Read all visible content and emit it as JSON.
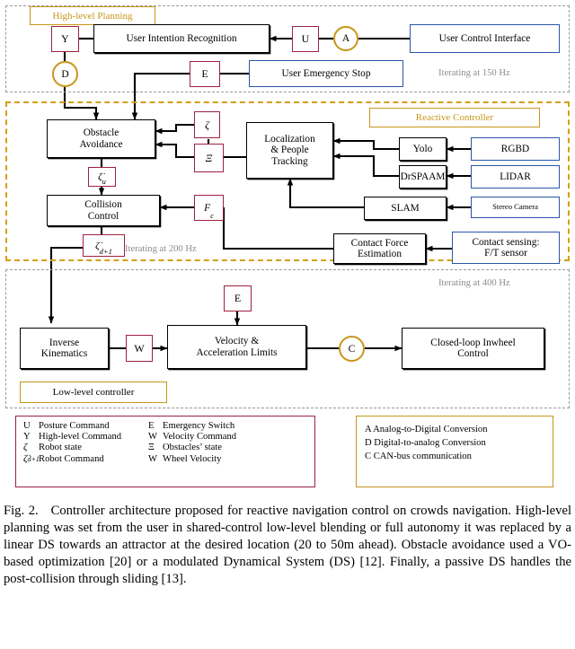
{
  "figure": {
    "sections": [
      {
        "id": "high-level-planning",
        "title": "High-level Planning",
        "rate": "Iterating at 150 Hz"
      },
      {
        "id": "reactive-controller",
        "title": "Reactive Controller",
        "rate": "Iterating at 200 Hz"
      },
      {
        "id": "low-level-controller",
        "title": "Low-level controller",
        "rate": "Iterating at 400 Hz"
      }
    ],
    "nodes": {
      "user_intention_recognition": "User Intention Recognition",
      "user_control_interface": "User Control Interface",
      "user_emergency_stop": "User Emergency Stop",
      "obstacle_avoidance_l1": "Obstacle",
      "obstacle_avoidance_l2": "Avoidance",
      "collision_control_l1": "Collision",
      "collision_control_l2": "Control",
      "localization_l1": "Localization",
      "localization_l2": "& People",
      "localization_l3": "Tracking",
      "yolo": "Yolo",
      "drspaam": "DrSPAAM",
      "slam": "SLAM",
      "rgbd": "RGBD",
      "lidar": "LIDAR",
      "stereo_camera": "Stereo Camera",
      "contact_force_l1": "Contact Force",
      "contact_force_l2": "Estimation",
      "contact_sensing_l1": "Contact sensing:",
      "contact_sensing_l2": "F/T sensor",
      "inverse_kinematics_l1": "Inverse",
      "inverse_kinematics_l2": "Kinematics",
      "velocity_limits_l1": "Velocity &",
      "velocity_limits_l2": "Acceleration Limits",
      "closed_loop_l1": "Closed-loop Inwheel",
      "closed_loop_l2": "Control"
    },
    "signals": {
      "y": "Y",
      "u": "U",
      "e_top": "E",
      "e_low": "E",
      "zeta": "ζ",
      "xi": "Ξ",
      "zeta_u": "ζ",
      "zeta_u_sub": "u",
      "fc": "F",
      "fc_sub": "c",
      "zeta_d": "ζ",
      "zeta_d_sub": "d+1",
      "w": "W"
    },
    "converters": {
      "a": "A",
      "d": "D",
      "c": "C"
    },
    "legend_signals": {
      "rows": [
        {
          "sym": "U",
          "italic": false,
          "text": "Posture Command",
          "sym2": "E",
          "italic2": false,
          "text2": "Emergency Switch"
        },
        {
          "sym": "Y",
          "italic": false,
          "text": "High-level Command",
          "sym2": "W",
          "italic2": false,
          "text2": "Velocity Command"
        },
        {
          "sym": "ζ",
          "italic": true,
          "text": "Robot state",
          "sym2": "Ξ",
          "italic2": false,
          "text2": "Obstacles’ state"
        },
        {
          "sym": "ζd+1",
          "italic": true,
          "text": "Robot Command",
          "sym2": "W",
          "italic2": false,
          "text2": "Wheel Velocity"
        }
      ]
    },
    "legend_converters": {
      "lines": [
        "A Analog-to-Digital Conversion",
        "D Digital-to-analog Conversion",
        "C CAN-bus communication"
      ]
    },
    "colors": {
      "crimson": "#9e2140",
      "gold": "#c8961a",
      "blue": "#2b56a8",
      "gray_dash": "#9a9a9a",
      "rate_text": "#8c8c8c"
    }
  },
  "caption": {
    "label": "Fig. 2.",
    "text": "Controller architecture proposed for reactive navigation control on crowds navigation. High-level planning was set from the user in shared-control low-level blending or full autonomy it was replaced by a linear DS towards an attractor at the desired location (20 to 50m ahead). Obstacle avoidance used a VO-based optimization [20] or a modulated Dynamical System (DS) [12]. Finally, a passive DS handles the post-collision through sliding [13]."
  }
}
